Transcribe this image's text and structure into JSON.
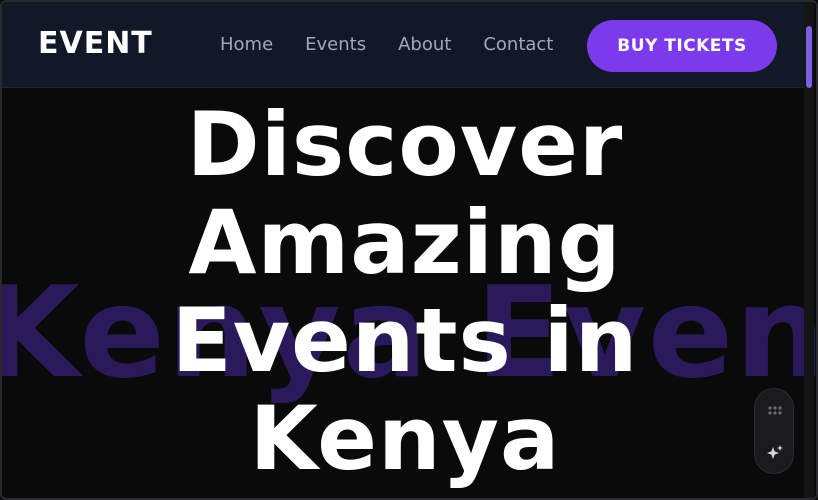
{
  "navbar": {
    "brand": "EVENT",
    "links": [
      {
        "label": "Home"
      },
      {
        "label": "Events"
      },
      {
        "label": "About"
      },
      {
        "label": "Contact"
      }
    ],
    "cta_label": "BUY TICKETS"
  },
  "hero": {
    "lines": [
      "Discover",
      "Amazing",
      "Events in",
      "Kenya"
    ],
    "background_text": "Kenya Events"
  },
  "floating_toolbar": {
    "icons": [
      "grid-dots-icon",
      "sparkle-icon"
    ]
  },
  "colors": {
    "accent": "#7c3aed",
    "navbar_bg": "#111827",
    "page_bg": "#0a0a0a",
    "bg_text": "#2a1a5c"
  }
}
